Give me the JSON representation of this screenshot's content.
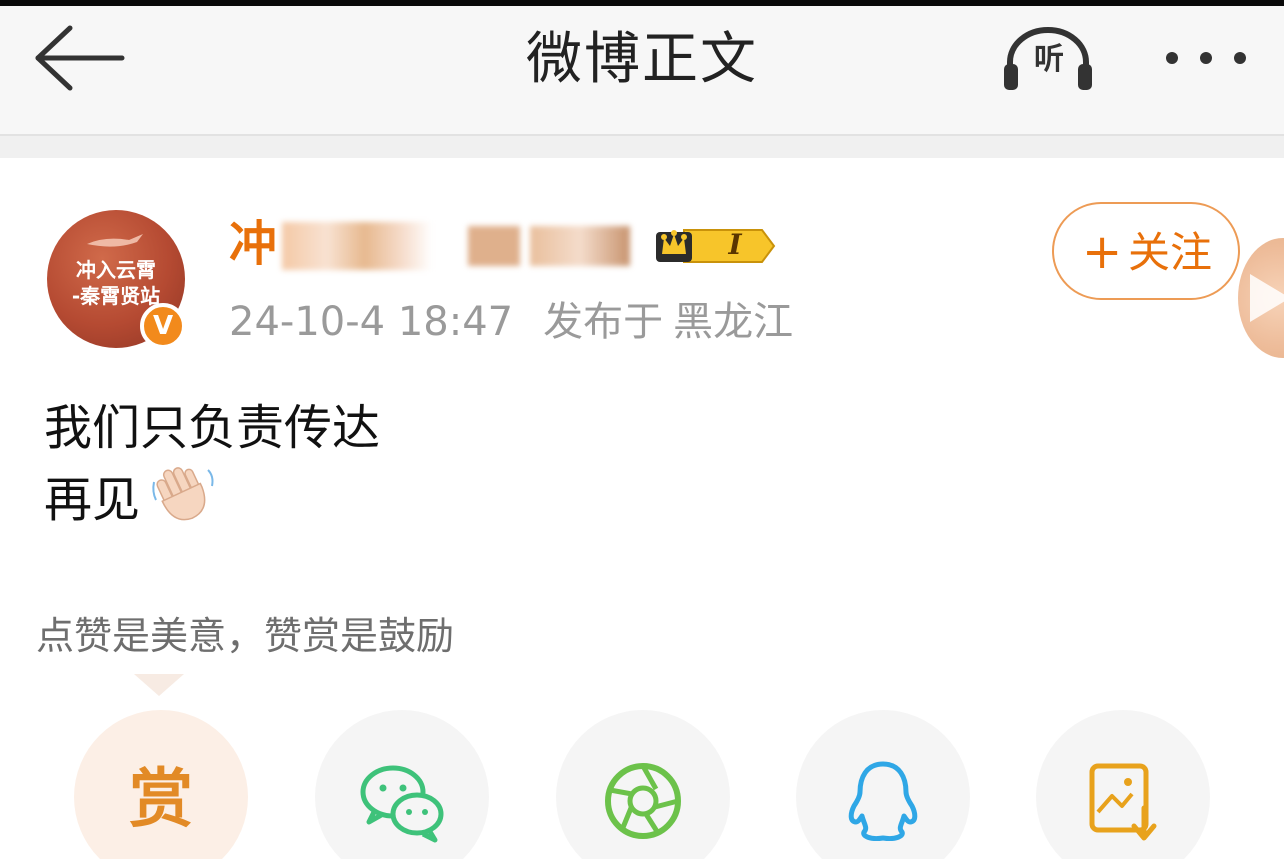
{
  "nav": {
    "title": "微博正文",
    "listen_label": "听",
    "back_icon": "back-arrow-icon",
    "more_icon": "more-dots-icon"
  },
  "post": {
    "avatar_line1": "冲入云霄",
    "avatar_line2": "-秦霄贤站",
    "username_visible": "冲",
    "level_label": "I",
    "time": "24-10-4 18:47",
    "published_in": "发布于",
    "location": "黑龙江",
    "body_line1": "我们只负责传达",
    "body_line2": "再见",
    "follow_plus": "+",
    "follow_label": "关注"
  },
  "reward": {
    "note": "点赞是美意，赞赏是鼓励",
    "reward_glyph": "赏"
  },
  "share": {
    "items": [
      "reward",
      "wechat",
      "moments",
      "qq",
      "save-image"
    ]
  },
  "colors": {
    "accent": "#e8700a",
    "follow_border": "#ed9b55",
    "wechat_green": "#3ec27a",
    "moments_green": "#6cc24a",
    "qq_blue": "#2fa7e6",
    "save_orange": "#e8a21c"
  }
}
